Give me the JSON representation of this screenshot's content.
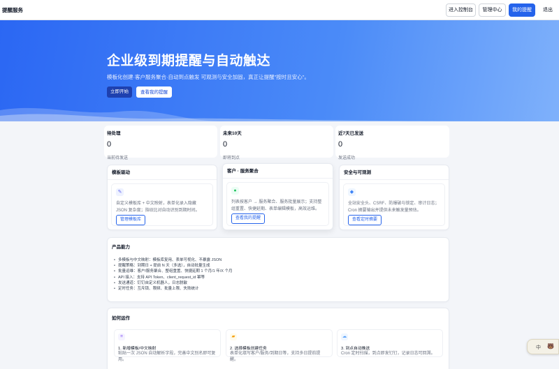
{
  "nav": {
    "brand": "提醒服务",
    "console": "进入控制台",
    "admin": "管理中心",
    "my_reminders": "我的提醒",
    "logout": "退出"
  },
  "hero": {
    "title": "企业级到期提醒与自动触达",
    "subtitle": "模板化创建·客户服务聚合·自动到点触发 可观测与安全加固，真正让提醒\"按时且安心\"。",
    "start": "立即开始",
    "view": "查看我的提醒"
  },
  "stats": [
    {
      "label": "待处理",
      "value": "0",
      "sub": "当前待发送"
    },
    {
      "label": "未来10天",
      "value": "0",
      "sub": "即将到点"
    },
    {
      "label": "近7天已发送",
      "value": "0",
      "sub": "发送成功"
    }
  ],
  "features": [
    {
      "title": "模板驱动",
      "icon": "template-icon",
      "icon_glyph": "✎",
      "text": "自定义模板库 + 中文映射，表单化录入隐藏 JSON 复杂度；指纹比对自动识别到期时间。",
      "button": "管理模板库"
    },
    {
      "title": "客户 · 服务聚合",
      "icon": "aggregate-icon",
      "icon_glyph": "●",
      "text": "列表按客户 → 服务聚合、服务批量展示；支持整组重置、快捷延期、表单编辑模板，高效运维。",
      "button": "查看我的提醒"
    },
    {
      "title": "安全与可观测",
      "icon": "shield-icon",
      "icon_glyph": "◆",
      "text": "全站安全头、CSRF、防爆破与锁定、审计日志；Cron 摘要输出并提供未来触发量预估。",
      "button": "查看定时摘要"
    }
  ],
  "capabilities": {
    "title": "产品能力",
    "items": [
      "多模板与中文映射：模板库复用、表单可视化、不暴露 JSON",
      "提醒策略：到期日 + 提前 N 天（多选），自动批量生成",
      "批量运维：客户/服务聚合、整组重置、快捷延期 1 个月/1 年/X 个月",
      "API 接入：支持 API Token、client_request_id 幂等",
      "发送通道：钉钉自定义机器人，日志脱敏",
      "定时任务：互斥锁、限频、批量上限、失败统计"
    ]
  },
  "how": {
    "title": "如何运作",
    "steps": [
      {
        "icon": "list-icon",
        "icon_glyph": "≡",
        "title": "1. 新增模板/中文映射",
        "desc": "粘贴一次 JSON 自动解析字段，完善中文别名即可复用。"
      },
      {
        "icon": "folder-icon",
        "icon_glyph": "▰",
        "title": "2. 选择模板创建任务",
        "desc": "表单化填写客户/服务/到期日等，支持多日提前提醒。"
      },
      {
        "icon": "cloud-icon",
        "icon_glyph": "☁",
        "title": "3. 到点自动推送",
        "desc": "Cron 定时扫描，到点即发钉钉，记录日志可回溯。"
      }
    ]
  },
  "widget": {
    "char": "中",
    "icon": "bear-icon",
    "glyph": "🐻"
  },
  "colors": {
    "primary": "#2563eb",
    "hero_start": "#2b67f3",
    "hero_end": "#7fb1fb"
  }
}
